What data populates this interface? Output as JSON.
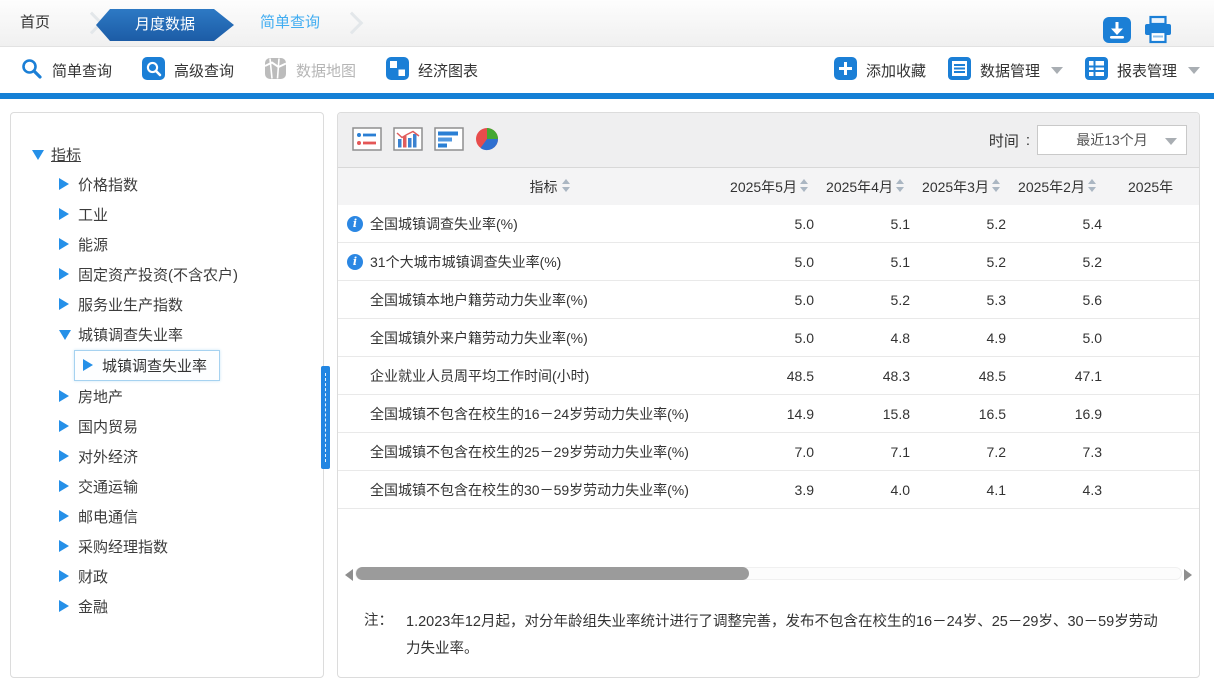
{
  "breadcrumb": {
    "home": "首页",
    "active": "月度数据",
    "link": "简单查询"
  },
  "toolbar": {
    "simple_query": "简单查询",
    "advanced_query": "高级查询",
    "data_map": "数据地图",
    "economic_charts": "经济图表",
    "add_favorite": "添加收藏",
    "data_manage": "数据管理",
    "report_manage": "报表管理"
  },
  "sidebar": {
    "root_label": "指标",
    "items": [
      {
        "label": "价格指数"
      },
      {
        "label": "工业"
      },
      {
        "label": "能源"
      },
      {
        "label": "固定资产投资(不含农户)"
      },
      {
        "label": "服务业生产指数"
      },
      {
        "label": "城镇调查失业率",
        "expanded": true
      },
      {
        "label": "城镇调查失业率",
        "selected": true,
        "child": true
      },
      {
        "label": "房地产"
      },
      {
        "label": "国内贸易"
      },
      {
        "label": "对外经济"
      },
      {
        "label": "交通运输"
      },
      {
        "label": "邮电通信"
      },
      {
        "label": "采购经理指数"
      },
      {
        "label": "财政"
      },
      {
        "label": "金融"
      }
    ]
  },
  "panel": {
    "time_label": "时间",
    "time_separator": ":",
    "time_value": "最近13个月"
  },
  "table": {
    "info_glyph": "i",
    "columns": [
      "指标",
      "2025年5月",
      "2025年4月",
      "2025年3月",
      "2025年2月",
      "2025年"
    ],
    "rows": [
      {
        "label": "全国城镇调查失业率(%)",
        "info": true,
        "values": [
          "5.0",
          "5.1",
          "5.2",
          "5.4"
        ]
      },
      {
        "label": "31个大城市城镇调查失业率(%)",
        "info": true,
        "values": [
          "5.0",
          "5.1",
          "5.2",
          "5.2"
        ]
      },
      {
        "label": "全国城镇本地户籍劳动力失业率(%)",
        "info": false,
        "values": [
          "5.0",
          "5.2",
          "5.3",
          "5.6"
        ]
      },
      {
        "label": "全国城镇外来户籍劳动力失业率(%)",
        "info": false,
        "values": [
          "5.0",
          "4.8",
          "4.9",
          "5.0"
        ]
      },
      {
        "label": "企业就业人员周平均工作时间(小时)",
        "info": false,
        "values": [
          "48.5",
          "48.3",
          "48.5",
          "47.1"
        ]
      },
      {
        "label": "全国城镇不包含在校生的16－24岁劳动力失业率(%)",
        "info": false,
        "values": [
          "14.9",
          "15.8",
          "16.5",
          "16.9"
        ]
      },
      {
        "label": "全国城镇不包含在校生的25－29岁劳动力失业率(%)",
        "info": false,
        "values": [
          "7.0",
          "7.1",
          "7.2",
          "7.3"
        ]
      },
      {
        "label": "全国城镇不包含在校生的30－59岁劳动力失业率(%)",
        "info": false,
        "values": [
          "3.9",
          "4.0",
          "4.1",
          "4.3"
        ]
      }
    ]
  },
  "note": {
    "prefix": "注：",
    "text": "1.2023年12月起，对分年龄组失业率统计进行了调整完善，发布不包含在校生的16－24岁、25－29岁、30－59岁劳动力失业率。"
  },
  "icons": {
    "header": [
      "download-icon",
      "printer-icon"
    ],
    "toolbar": [
      "search-icon",
      "advanced-search-icon",
      "data-map-icon",
      "economic-chart-icon",
      "add-icon",
      "data-manage-icon",
      "report-manage-icon"
    ],
    "views": [
      "table-view-icon",
      "column-chart-view-icon",
      "bar-chart-view-icon",
      "pie-chart-view-icon"
    ],
    "misc": [
      "info-icon",
      "sort-icon",
      "caret-down-icon",
      "tree-collapsed-icon",
      "tree-expanded-icon",
      "scroll-left-icon",
      "scroll-right-icon"
    ]
  },
  "colors": {
    "accent_blue": "#1b7fd6",
    "toolbar_bar_blue": "#1580d6",
    "active_tab_blue": "#1c5ca6",
    "link_blue": "#42adf1",
    "tree_arrow_blue": "#2590e8",
    "selected_node_border": "#a6d2f0",
    "scroll_thumb_gray": "#9b9b9b"
  }
}
